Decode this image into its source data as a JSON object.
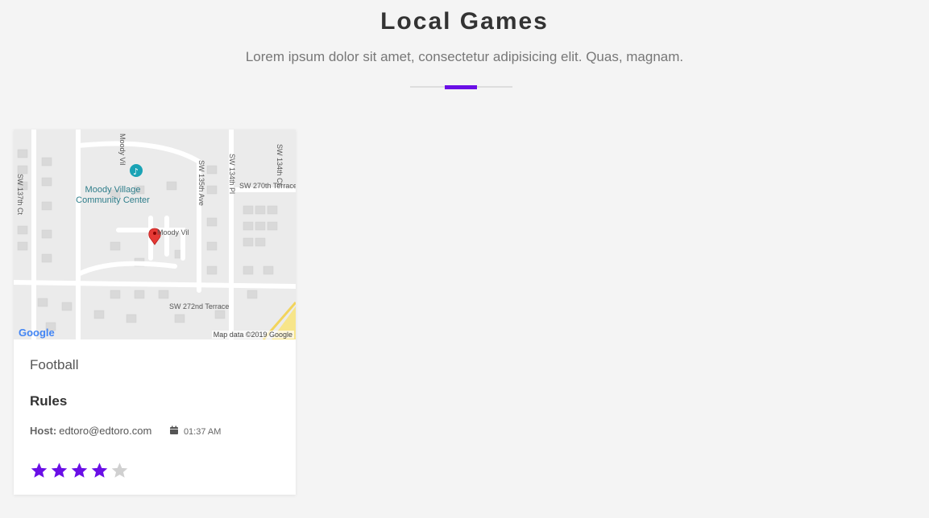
{
  "section": {
    "title": "Local Games",
    "subtitle": "Lorem ipsum dolor sit amet, consectetur adipisicing elit. Quas, magnam.",
    "accent_color": "#6a0fe6"
  },
  "card": {
    "map": {
      "poi_label": "Moody Village Community Center",
      "pin_label": "Moody Vil",
      "street_labels": [
        "SW 137th Ct",
        "Moody Vil",
        "SW 135th Ave",
        "SW 134th Pl",
        "SW 134th Ct",
        "SW 270th Terrace",
        "SW 272nd Terrace"
      ],
      "logo": "Google",
      "attribution": "Map data ©2019 Google"
    },
    "sport": "Football",
    "heading": "Rules",
    "host_label": "Host:",
    "host_email": "edtoro@edtoro.com",
    "time": "01:37 AM",
    "calendar_icon": "calendar-icon",
    "rating": 4,
    "rating_max": 5,
    "star_color": "#6a0fe6",
    "star_empty_color": "#d0d0d0"
  }
}
